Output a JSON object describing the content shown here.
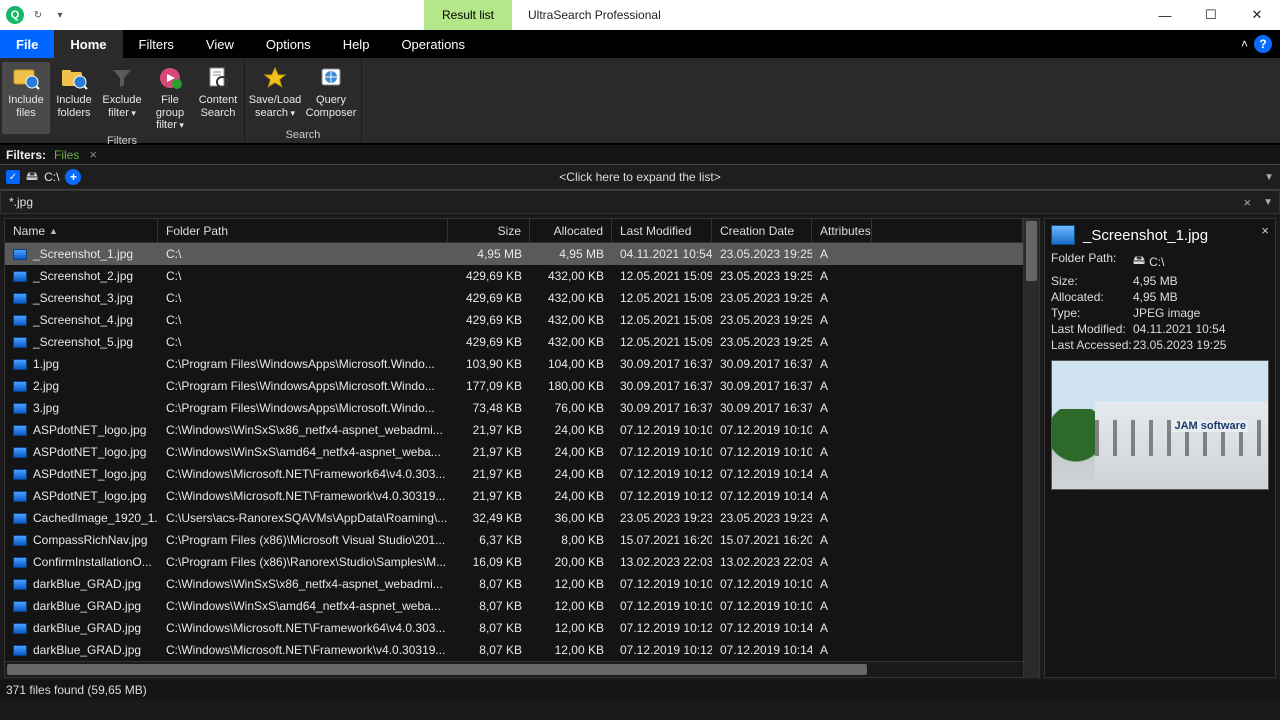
{
  "window": {
    "tag": "Result list",
    "title": "UltraSearch Professional"
  },
  "menu": {
    "file": "File",
    "home": "Home",
    "filters": "Filters",
    "view": "View",
    "options": "Options",
    "help": "Help",
    "operations": "Operations"
  },
  "ribbon": {
    "filters": {
      "include_files": "Include files",
      "include_folders": "Include folders",
      "exclude_filter": "Exclude filter",
      "file_group": "File group filter",
      "content_search": "Content Search",
      "label": "Filters"
    },
    "search": {
      "save_load": "Save/Load search",
      "query_composer": "Query Composer",
      "label": "Search"
    }
  },
  "path": {
    "label": "Filters:",
    "crumb": "Files"
  },
  "expand": {
    "drive": "C:\\",
    "hint": "<Click here to expand the list>"
  },
  "query": "*.jpg",
  "columns": {
    "name": "Name",
    "path": "Folder Path",
    "size": "Size",
    "alloc": "Allocated",
    "mod": "Last Modified",
    "cre": "Creation Date",
    "attr": "Attributes"
  },
  "rows": [
    {
      "name": "_Screenshot_1.jpg",
      "path": "C:\\",
      "size": "4,95 MB",
      "alloc": "4,95 MB",
      "mod": "04.11.2021 10:54",
      "cre": "23.05.2023 19:25",
      "attr": "A"
    },
    {
      "name": "_Screenshot_2.jpg",
      "path": "C:\\",
      "size": "429,69 KB",
      "alloc": "432,00 KB",
      "mod": "12.05.2021 15:09",
      "cre": "23.05.2023 19:25",
      "attr": "A"
    },
    {
      "name": "_Screenshot_3.jpg",
      "path": "C:\\",
      "size": "429,69 KB",
      "alloc": "432,00 KB",
      "mod": "12.05.2021 15:09",
      "cre": "23.05.2023 19:25",
      "attr": "A"
    },
    {
      "name": "_Screenshot_4.jpg",
      "path": "C:\\",
      "size": "429,69 KB",
      "alloc": "432,00 KB",
      "mod": "12.05.2021 15:09",
      "cre": "23.05.2023 19:25",
      "attr": "A"
    },
    {
      "name": "_Screenshot_5.jpg",
      "path": "C:\\",
      "size": "429,69 KB",
      "alloc": "432,00 KB",
      "mod": "12.05.2021 15:09",
      "cre": "23.05.2023 19:25",
      "attr": "A"
    },
    {
      "name": "1.jpg",
      "path": "C:\\Program Files\\WindowsApps\\Microsoft.Windo...",
      "size": "103,90 KB",
      "alloc": "104,00 KB",
      "mod": "30.09.2017 16:37",
      "cre": "30.09.2017 16:37",
      "attr": "A"
    },
    {
      "name": "2.jpg",
      "path": "C:\\Program Files\\WindowsApps\\Microsoft.Windo...",
      "size": "177,09 KB",
      "alloc": "180,00 KB",
      "mod": "30.09.2017 16:37",
      "cre": "30.09.2017 16:37",
      "attr": "A"
    },
    {
      "name": "3.jpg",
      "path": "C:\\Program Files\\WindowsApps\\Microsoft.Windo...",
      "size": "73,48 KB",
      "alloc": "76,00 KB",
      "mod": "30.09.2017 16:37",
      "cre": "30.09.2017 16:37",
      "attr": "A"
    },
    {
      "name": "ASPdotNET_logo.jpg",
      "path": "C:\\Windows\\WinSxS\\x86_netfx4-aspnet_webadmi...",
      "size": "21,97 KB",
      "alloc": "24,00 KB",
      "mod": "07.12.2019 10:10",
      "cre": "07.12.2019 10:10",
      "attr": "A"
    },
    {
      "name": "ASPdotNET_logo.jpg",
      "path": "C:\\Windows\\WinSxS\\amd64_netfx4-aspnet_weba...",
      "size": "21,97 KB",
      "alloc": "24,00 KB",
      "mod": "07.12.2019 10:10",
      "cre": "07.12.2019 10:10",
      "attr": "A"
    },
    {
      "name": "ASPdotNET_logo.jpg",
      "path": "C:\\Windows\\Microsoft.NET\\Framework64\\v4.0.303...",
      "size": "21,97 KB",
      "alloc": "24,00 KB",
      "mod": "07.12.2019 10:12",
      "cre": "07.12.2019 10:14",
      "attr": "A"
    },
    {
      "name": "ASPdotNET_logo.jpg",
      "path": "C:\\Windows\\Microsoft.NET\\Framework\\v4.0.30319...",
      "size": "21,97 KB",
      "alloc": "24,00 KB",
      "mod": "07.12.2019 10:12",
      "cre": "07.12.2019 10:14",
      "attr": "A"
    },
    {
      "name": "CachedImage_1920_1...",
      "path": "C:\\Users\\acs-RanorexSQAVMs\\AppData\\Roaming\\...",
      "size": "32,49 KB",
      "alloc": "36,00 KB",
      "mod": "23.05.2023 19:23",
      "cre": "23.05.2023 19:23",
      "attr": "A"
    },
    {
      "name": "CompassRichNav.jpg",
      "path": "C:\\Program Files (x86)\\Microsoft Visual Studio\\201...",
      "size": "6,37 KB",
      "alloc": "8,00 KB",
      "mod": "15.07.2021 16:20",
      "cre": "15.07.2021 16:20",
      "attr": "A"
    },
    {
      "name": "ConfirmInstallationO...",
      "path": "C:\\Program Files (x86)\\Ranorex\\Studio\\Samples\\M...",
      "size": "16,09 KB",
      "alloc": "20,00 KB",
      "mod": "13.02.2023 22:03",
      "cre": "13.02.2023 22:03",
      "attr": "A"
    },
    {
      "name": "darkBlue_GRAD.jpg",
      "path": "C:\\Windows\\WinSxS\\x86_netfx4-aspnet_webadmi...",
      "size": "8,07 KB",
      "alloc": "12,00 KB",
      "mod": "07.12.2019 10:10",
      "cre": "07.12.2019 10:10",
      "attr": "A"
    },
    {
      "name": "darkBlue_GRAD.jpg",
      "path": "C:\\Windows\\WinSxS\\amd64_netfx4-aspnet_weba...",
      "size": "8,07 KB",
      "alloc": "12,00 KB",
      "mod": "07.12.2019 10:10",
      "cre": "07.12.2019 10:10",
      "attr": "A"
    },
    {
      "name": "darkBlue_GRAD.jpg",
      "path": "C:\\Windows\\Microsoft.NET\\Framework64\\v4.0.303...",
      "size": "8,07 KB",
      "alloc": "12,00 KB",
      "mod": "07.12.2019 10:12",
      "cre": "07.12.2019 10:14",
      "attr": "A"
    },
    {
      "name": "darkBlue_GRAD.jpg",
      "path": "C:\\Windows\\Microsoft.NET\\Framework\\v4.0.30319...",
      "size": "8,07 KB",
      "alloc": "12,00 KB",
      "mod": "07.12.2019 10:12",
      "cre": "07.12.2019 10:14",
      "attr": "A"
    }
  ],
  "preview": {
    "filename": "_Screenshot_1.jpg",
    "folder_k": "Folder Path:",
    "folder_v": "C:\\",
    "size_k": "Size:",
    "size_v": "4,95 MB",
    "alloc_k": "Allocated:",
    "alloc_v": "4,95 MB",
    "type_k": "Type:",
    "type_v": "JPEG image",
    "mod_k": "Last Modified:",
    "mod_v": "04.11.2021 10:54",
    "acc_k": "Last Accessed:",
    "acc_v": "23.05.2023 19:25",
    "logo": "JAM software"
  },
  "status": "371 files found (59,65 MB)"
}
